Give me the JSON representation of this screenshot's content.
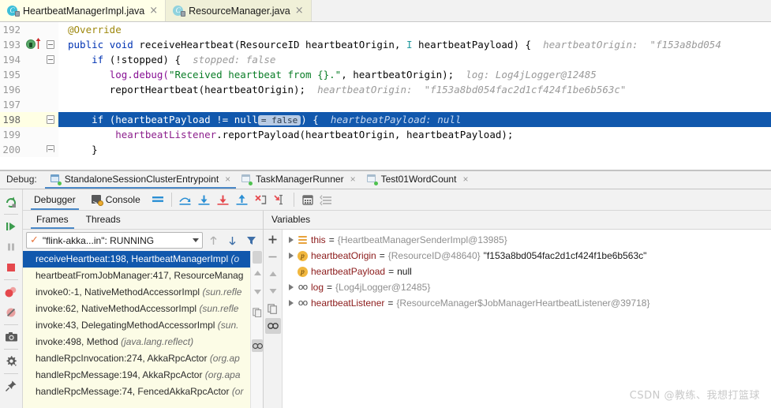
{
  "window": {
    "title": "IntelliJ IDEA Debugger"
  },
  "editor_tabs": [
    {
      "label": "HeartbeatManagerImpl.java",
      "icon": "java-class-icon",
      "active": true,
      "close": "×"
    },
    {
      "label": "ResourceManager.java",
      "icon": "java-class-icon",
      "active": false,
      "close": "×"
    }
  ],
  "code": {
    "lines": [
      {
        "num": "192",
        "current": false,
        "highlighted": false
      },
      {
        "num": "193",
        "current": false,
        "highlighted": false
      },
      {
        "num": "194",
        "current": false,
        "highlighted": false
      },
      {
        "num": "195",
        "current": false,
        "highlighted": false
      },
      {
        "num": "196",
        "current": false,
        "highlighted": false
      },
      {
        "num": "197",
        "current": false,
        "highlighted": false
      },
      {
        "num": "198",
        "current": true,
        "highlighted": true
      },
      {
        "num": "199",
        "current": false,
        "highlighted": false
      },
      {
        "num": "200",
        "current": false,
        "highlighted": false
      }
    ],
    "text": {
      "l192_annotation": "@Override",
      "l193_kw1": "public",
      "l193_kw2": "void",
      "l193_method": " receiveHeartbeat(ResourceID heartbeatOrigin, ",
      "l193_type": "I",
      "l193_rest": " heartbeatPayload) {",
      "l193_hint": "heartbeatOrigin:  \"f153a8bd054",
      "l194_kw": "if",
      "l194_cond": " (!stopped) {",
      "l194_hint": "stopped: false",
      "l195_call": "log.debug(",
      "l195_str": "\"Received heartbeat from {}.\"",
      "l195_rest": ", heartbeatOrigin);",
      "l195_hint": "log: Log4jLogger@12485",
      "l196_call": "reportHeartbeat(heartbeatOrigin);",
      "l196_hint": "heartbeatOrigin:  \"f153a8bd054fac2d1cf424f1be6b563c\"",
      "l198_kw": "if",
      "l198_cond1": " (heartbeatPayload != null",
      "l198_inlay": "= false",
      "l198_cond2": ") {",
      "l198_hint": "heartbeatPayload: null",
      "l199_obj": "heartbeatListener",
      "l199_rest": ".reportPayload(heartbeatOrigin, heartbeatPayload);",
      "l200_brace": "}"
    }
  },
  "debug_toolwindow": {
    "label": "Debug:",
    "run_tabs": [
      {
        "label": "StandaloneSessionClusterEntrypoint",
        "active": true,
        "close": "×"
      },
      {
        "label": "TaskManagerRunner",
        "active": false,
        "close": "×"
      },
      {
        "label": "Test01WordCount",
        "active": false,
        "close": "×"
      }
    ],
    "left_toolbar": [
      {
        "name": "rerun-icon"
      },
      {
        "name": "resume-program-icon"
      },
      {
        "name": "pause-program-icon"
      },
      {
        "name": "stop-icon"
      },
      {
        "name": "view-breakpoints-icon"
      },
      {
        "name": "mute-breakpoints-icon"
      },
      {
        "name": "camera-snapshot-icon"
      },
      {
        "name": "settings-gear-icon"
      },
      {
        "name": "pin-tab-icon"
      }
    ],
    "tabs": [
      {
        "label": "Debugger",
        "active": true
      },
      {
        "label": "Console",
        "active": false,
        "icon": "console-icon"
      }
    ],
    "toolbar_buttons": [
      {
        "name": "layout-icon"
      },
      {
        "name": "step-over-icon"
      },
      {
        "name": "step-into-icon"
      },
      {
        "name": "force-step-into-icon"
      },
      {
        "name": "step-out-icon"
      },
      {
        "name": "drop-frame-icon"
      },
      {
        "name": "run-to-cursor-icon"
      },
      {
        "name": "evaluate-expression-icon"
      },
      {
        "name": "settings-list-icon"
      }
    ]
  },
  "frames": {
    "tabs": [
      {
        "label": "Frames",
        "active": true
      },
      {
        "label": "Threads",
        "active": false
      }
    ],
    "thread_selector": {
      "value": "\"flink-akka...in\": RUNNING",
      "status_icon": "check-icon"
    },
    "thread_buttons": [
      {
        "name": "move-up-icon"
      },
      {
        "name": "move-down-icon"
      },
      {
        "name": "filter-icon"
      }
    ],
    "items": [
      {
        "method": "receiveHeartbeat:198, HeartbeatManagerImpl ",
        "pkg": "(o",
        "selected": true
      },
      {
        "method": "heartbeatFromJobManager:417, ResourceManag",
        "pkg": "",
        "selected": false
      },
      {
        "method": "invoke0:-1, NativeMethodAccessorImpl ",
        "pkg": "(sun.refle",
        "selected": false
      },
      {
        "method": "invoke:62, NativeMethodAccessorImpl ",
        "pkg": "(sun.refle",
        "selected": false
      },
      {
        "method": "invoke:43, DelegatingMethodAccessorImpl ",
        "pkg": "(sun.",
        "selected": false
      },
      {
        "method": "invoke:498, Method ",
        "pkg": "(java.lang.reflect)",
        "selected": false
      },
      {
        "method": "handleRpcInvocation:274, AkkaRpcActor ",
        "pkg": "(org.ap",
        "selected": false
      },
      {
        "method": "handleRpcMessage:194, AkkaRpcActor ",
        "pkg": "(org.apa",
        "selected": false
      },
      {
        "method": "handleRpcMessage:74, FencedAkkaRpcActor ",
        "pkg": "(or",
        "selected": false
      }
    ]
  },
  "variables": {
    "header": "Variables",
    "toolbar": [
      {
        "name": "add-watch-icon",
        "glyph": "+",
        "active": false
      },
      {
        "name": "remove-watch-icon",
        "glyph": "−",
        "active": false
      },
      {
        "name": "move-watch-up-icon",
        "glyph": "▲",
        "active": false
      },
      {
        "name": "move-watch-down-icon",
        "glyph": "▼",
        "active": false
      },
      {
        "name": "copy-value-icon",
        "glyph": "❐",
        "active": false
      },
      {
        "name": "watches-icon",
        "glyph": "oo",
        "active": true
      }
    ],
    "rows": [
      {
        "expandable": true,
        "icon": "field-icon",
        "name": "this",
        "eq": "=",
        "ref": "{HeartbeatManagerSenderImpl@13985}",
        "str": ""
      },
      {
        "expandable": true,
        "icon": "param-icon",
        "name": "heartbeatOrigin",
        "eq": "=",
        "ref": "{ResourceID@48640}",
        "str": "\"f153a8bd054fac2d1cf424f1be6b563c\""
      },
      {
        "expandable": false,
        "icon": "param-icon",
        "name": "heartbeatPayload",
        "eq": "=",
        "ref": "",
        "str": "null"
      },
      {
        "expandable": true,
        "icon": "object-icon",
        "name": "log",
        "eq": "=",
        "ref": "{Log4jLogger@12485}",
        "str": ""
      },
      {
        "expandable": true,
        "icon": "object-icon",
        "name": "heartbeatListener",
        "eq": "=",
        "ref": "{ResourceManager$JobManagerHeartbeatListener@39718}",
        "str": ""
      }
    ]
  },
  "watermark": {
    "text": "CSDN @教练、我想打篮球"
  },
  "colors": {
    "selection_blue": "#1158ad",
    "tab_underline": "#4a88c7",
    "frames_bg": "#fcfce6",
    "current_line": "#ffffe4",
    "keyword": "#0033b3",
    "string": "#0a7d27",
    "annotation": "#9e880d",
    "hint_gray": "#9a9a9a",
    "var_name_red": "#8b1a1a"
  }
}
